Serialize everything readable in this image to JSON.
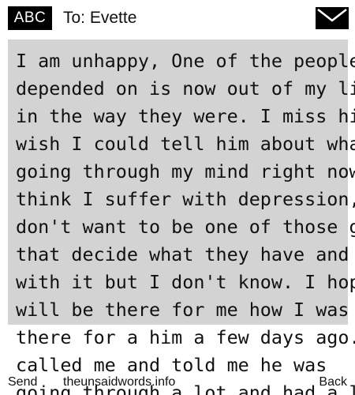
{
  "header": {
    "input_mode": "ABC",
    "recipient": "To: Evette",
    "send_icon": "envelope-icon"
  },
  "message": {
    "lines": [
      "I am unhappy, One of the people I",
      "depended on is now out of my life",
      "in the way they were. I miss him. I",
      "wish I could tell him about what's",
      "going through my mind right now. I",
      "think I suffer with depression, I",
      "don't want to be one of those girls",
      "that decide what they have and go",
      "with it but I don't know. I hope he",
      "will be there for me how I was",
      "there for a him a few days ago. He",
      "called me and told me he was",
      "going through a lot and had a lot of"
    ]
  },
  "softkeys": {
    "left": "Send",
    "middle": "theunsaidwords.info",
    "right": "Back"
  },
  "colors": {
    "message_background": "#d3d3d3",
    "badge_background": "#000000",
    "text": "#111111"
  }
}
